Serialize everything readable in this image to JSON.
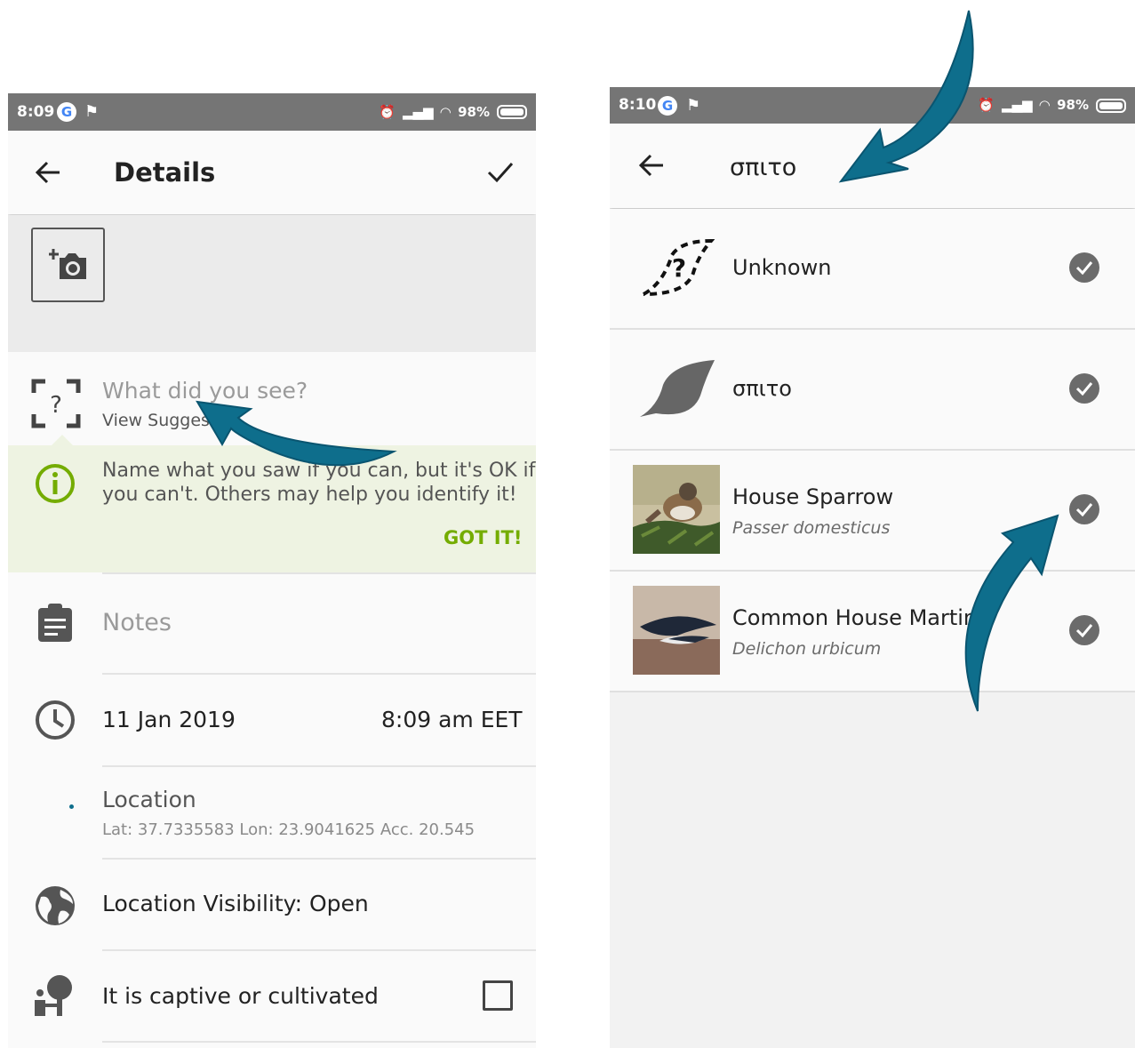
{
  "left_screen": {
    "status": {
      "time": "8:09",
      "battery": "98%"
    },
    "toolbar": {
      "title": "Details"
    },
    "species": {
      "placeholder": "What did you see?",
      "suggestions": "View Sugges"
    },
    "tip": {
      "text_line1": "Name what you saw if you can, but it's OK if",
      "text_line2": "you can't. Others may help you identify it!",
      "dismiss": "GOT IT!"
    },
    "notes": {
      "placeholder": "Notes"
    },
    "datetime": {
      "date": "11 Jan 2019",
      "time": "8:09 am EET"
    },
    "location": {
      "title": "Location",
      "coords": "Lat: 37.7335583 Lon: 23.9041625 Acc. 20.545"
    },
    "visibility": {
      "label": "Location Visibility: Open"
    },
    "captive": {
      "label": "It is captive or cultivated",
      "checked": false
    }
  },
  "right_screen": {
    "status": {
      "time": "8:10",
      "battery": "98%"
    },
    "toolbar": {
      "query": "σπιτο"
    },
    "results": [
      {
        "name": "Unknown",
        "scientific": ""
      },
      {
        "name": "σπιτο",
        "scientific": ""
      },
      {
        "name": "House Sparrow",
        "scientific": "Passer domesticus"
      },
      {
        "name": "Common House Martin",
        "scientific": "Delichon urbicum"
      }
    ]
  },
  "colors": {
    "status_bar": "#757575",
    "tip_background": "#eef3e2",
    "tip_accent": "#74ac00",
    "annotation_arrow": "#0e6e8c",
    "check_icon": "#6b6b6b"
  }
}
